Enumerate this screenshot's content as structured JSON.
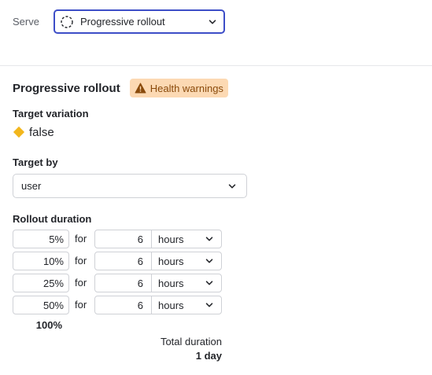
{
  "serve": {
    "label": "Serve",
    "selected": "Progressive rollout",
    "icon": "dashed-circle-icon"
  },
  "rollout": {
    "title": "Progressive rollout",
    "badge": {
      "icon": "warning-triangle-icon",
      "label": "Health warnings",
      "color": "#fcd9b3"
    },
    "target_variation": {
      "label": "Target variation",
      "value": "false",
      "color": "#f2b61c"
    },
    "target_by": {
      "label": "Target by",
      "value": "user"
    },
    "duration": {
      "label": "Rollout duration",
      "for_label": "for",
      "steps": [
        {
          "percent": "5%",
          "amount": "6",
          "unit": "hours"
        },
        {
          "percent": "10%",
          "amount": "6",
          "unit": "hours"
        },
        {
          "percent": "25%",
          "amount": "6",
          "unit": "hours"
        },
        {
          "percent": "50%",
          "amount": "6",
          "unit": "hours"
        }
      ],
      "final_percent": "100%",
      "total_label": "Total duration",
      "total_value": "1 day"
    }
  },
  "colors": {
    "accent": "#3d4ec7",
    "warning_text": "#8a4a0b"
  }
}
